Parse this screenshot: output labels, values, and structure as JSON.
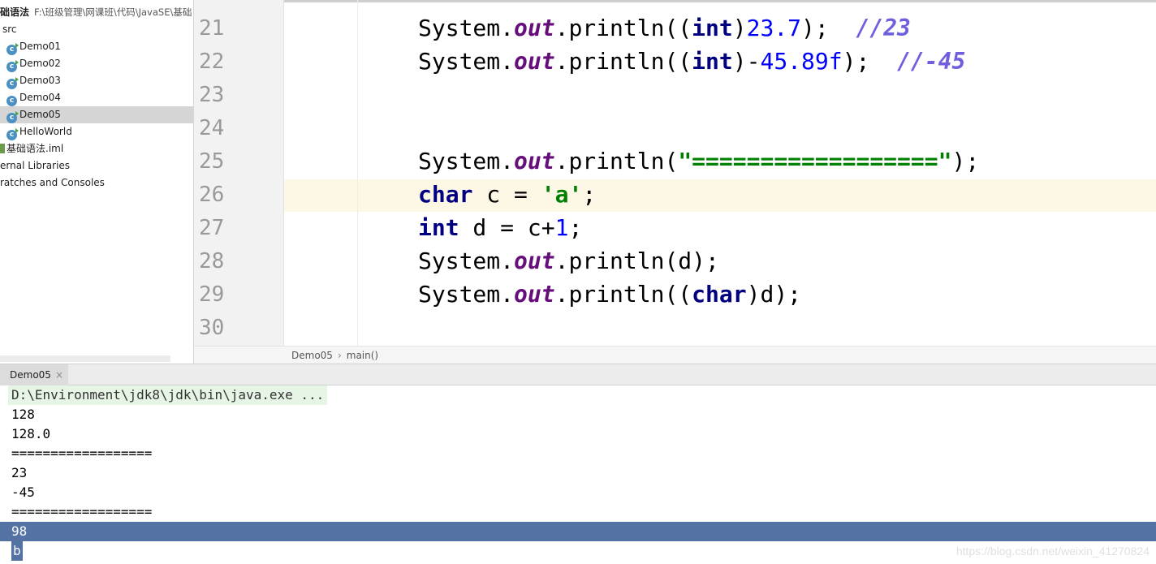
{
  "project": {
    "root_name": "础语法",
    "root_path": "F:\\班级管理\\网课班\\代码\\JavaSE\\基础",
    "src_label": "src",
    "classes": [
      "Demo01",
      "Demo02",
      "Demo03",
      "Demo04",
      "Demo05",
      "HelloWorld"
    ],
    "selected_class": "Demo05",
    "iml_file": "基础语法.iml",
    "external_libraries": "ernal Libraries",
    "scratches": "ratches and Consoles"
  },
  "editor": {
    "line_numbers": [
      "21",
      "22",
      "23",
      "24",
      "25",
      "26",
      "27",
      "28",
      "29",
      "30"
    ],
    "current_line": "26",
    "code": {
      "l21": {
        "a": "System.",
        "b": "out",
        "c": ".println((",
        "d": "int",
        "e": ")",
        "f": "23.7",
        "g": ");  ",
        "h": "//23"
      },
      "l22": {
        "a": "System.",
        "b": "out",
        "c": ".println((",
        "d": "int",
        "e": ")-",
        "f": "45.89f",
        "g": ");  ",
        "h": "//-45"
      },
      "l25": {
        "a": "System.",
        "b": "out",
        "c": ".println(",
        "s": "\"==================\"",
        "g": ");"
      },
      "l26": {
        "kw": "char",
        "a": " c = ",
        "s": "'a'",
        "g": ";"
      },
      "l27": {
        "kw": "int",
        "a": " d = c+",
        "n": "1",
        "g": ";"
      },
      "l28": {
        "a": "System.",
        "b": "out",
        "c": ".println(d);"
      },
      "l29": {
        "a": "System.",
        "b": "out",
        "c": ".println((",
        "d": "char",
        "e": ")d);"
      }
    }
  },
  "breadcrumb": {
    "class": "Demo05",
    "separator": "›",
    "method": "main()"
  },
  "run": {
    "tab_label": "Demo05",
    "close": "×",
    "command": "D:\\Environment\\jdk8\\jdk\\bin\\java.exe ...",
    "output": [
      "128",
      "128.0",
      "==================",
      "23",
      "-45",
      "==================",
      "98",
      "b"
    ]
  },
  "watermark": "https://blog.csdn.net/weixin_41270824",
  "colors": {
    "keyword": "#000080",
    "field": "#660e7a",
    "number": "#0000ff",
    "string": "#008000",
    "comment": "#6f5fdf",
    "selection": "#5572a5",
    "caret_row": "#fdf8e6"
  }
}
